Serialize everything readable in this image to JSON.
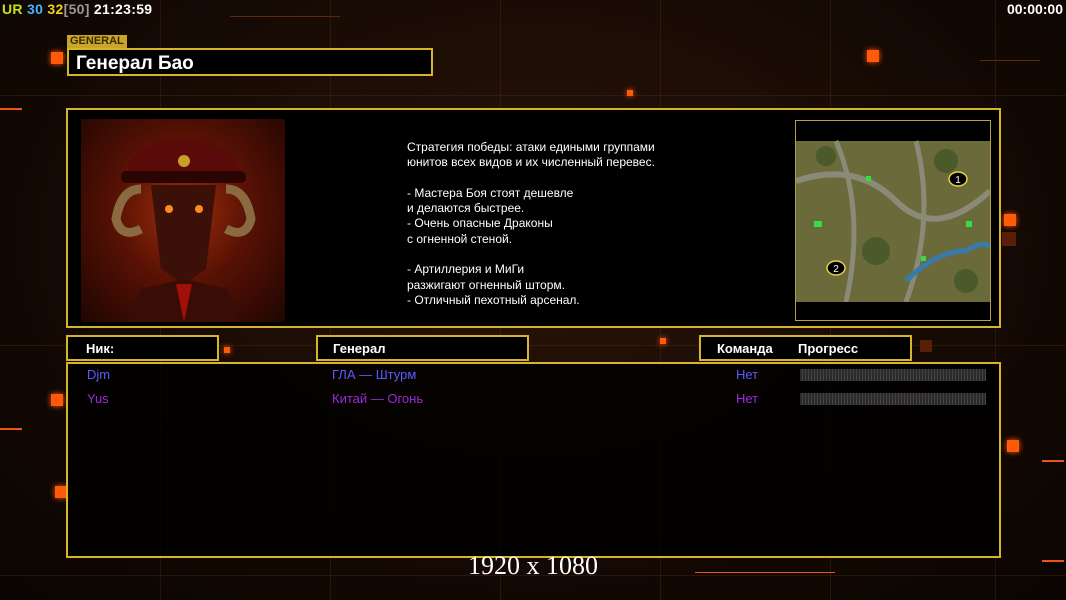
{
  "hud": {
    "ur": "UR",
    "fps": "30",
    "frames": "32",
    "frames_cap": "[50]",
    "clock": "21:23:59",
    "timer": "00:00:00"
  },
  "general": {
    "tag": "GENERAL",
    "name": "Генерал Бао",
    "description": "Стратегия победы: атаки едиными группами\nюнитов всех видов и их численный перевес.\n\n- Мастера Боя стоят дешевле\nи делаются быстрее.\n- Очень опасные Драконы\nс огненной стеной.\n\n- Артиллерия и МиГи\nразжигают огненный шторм.\n- Отличный пехотный арсенал.",
    "portrait_icon": "general-portrait",
    "map_icon": "minimap",
    "map_start_labels": [
      "1",
      "2"
    ]
  },
  "columns": {
    "nick": "Ник:",
    "general": "Генерал",
    "team": "Команда",
    "progress": "Прогресс"
  },
  "players": [
    {
      "nick": "Djm",
      "general": "ГЛА — Штурм",
      "team": "Нет",
      "color": "#5a5aff",
      "progress": 0
    },
    {
      "nick": "Yus",
      "general": "Китай — Огонь",
      "team": "Нет",
      "color": "#9a2ad8",
      "progress": 0
    }
  ],
  "resolution": "1920 x 1080"
}
